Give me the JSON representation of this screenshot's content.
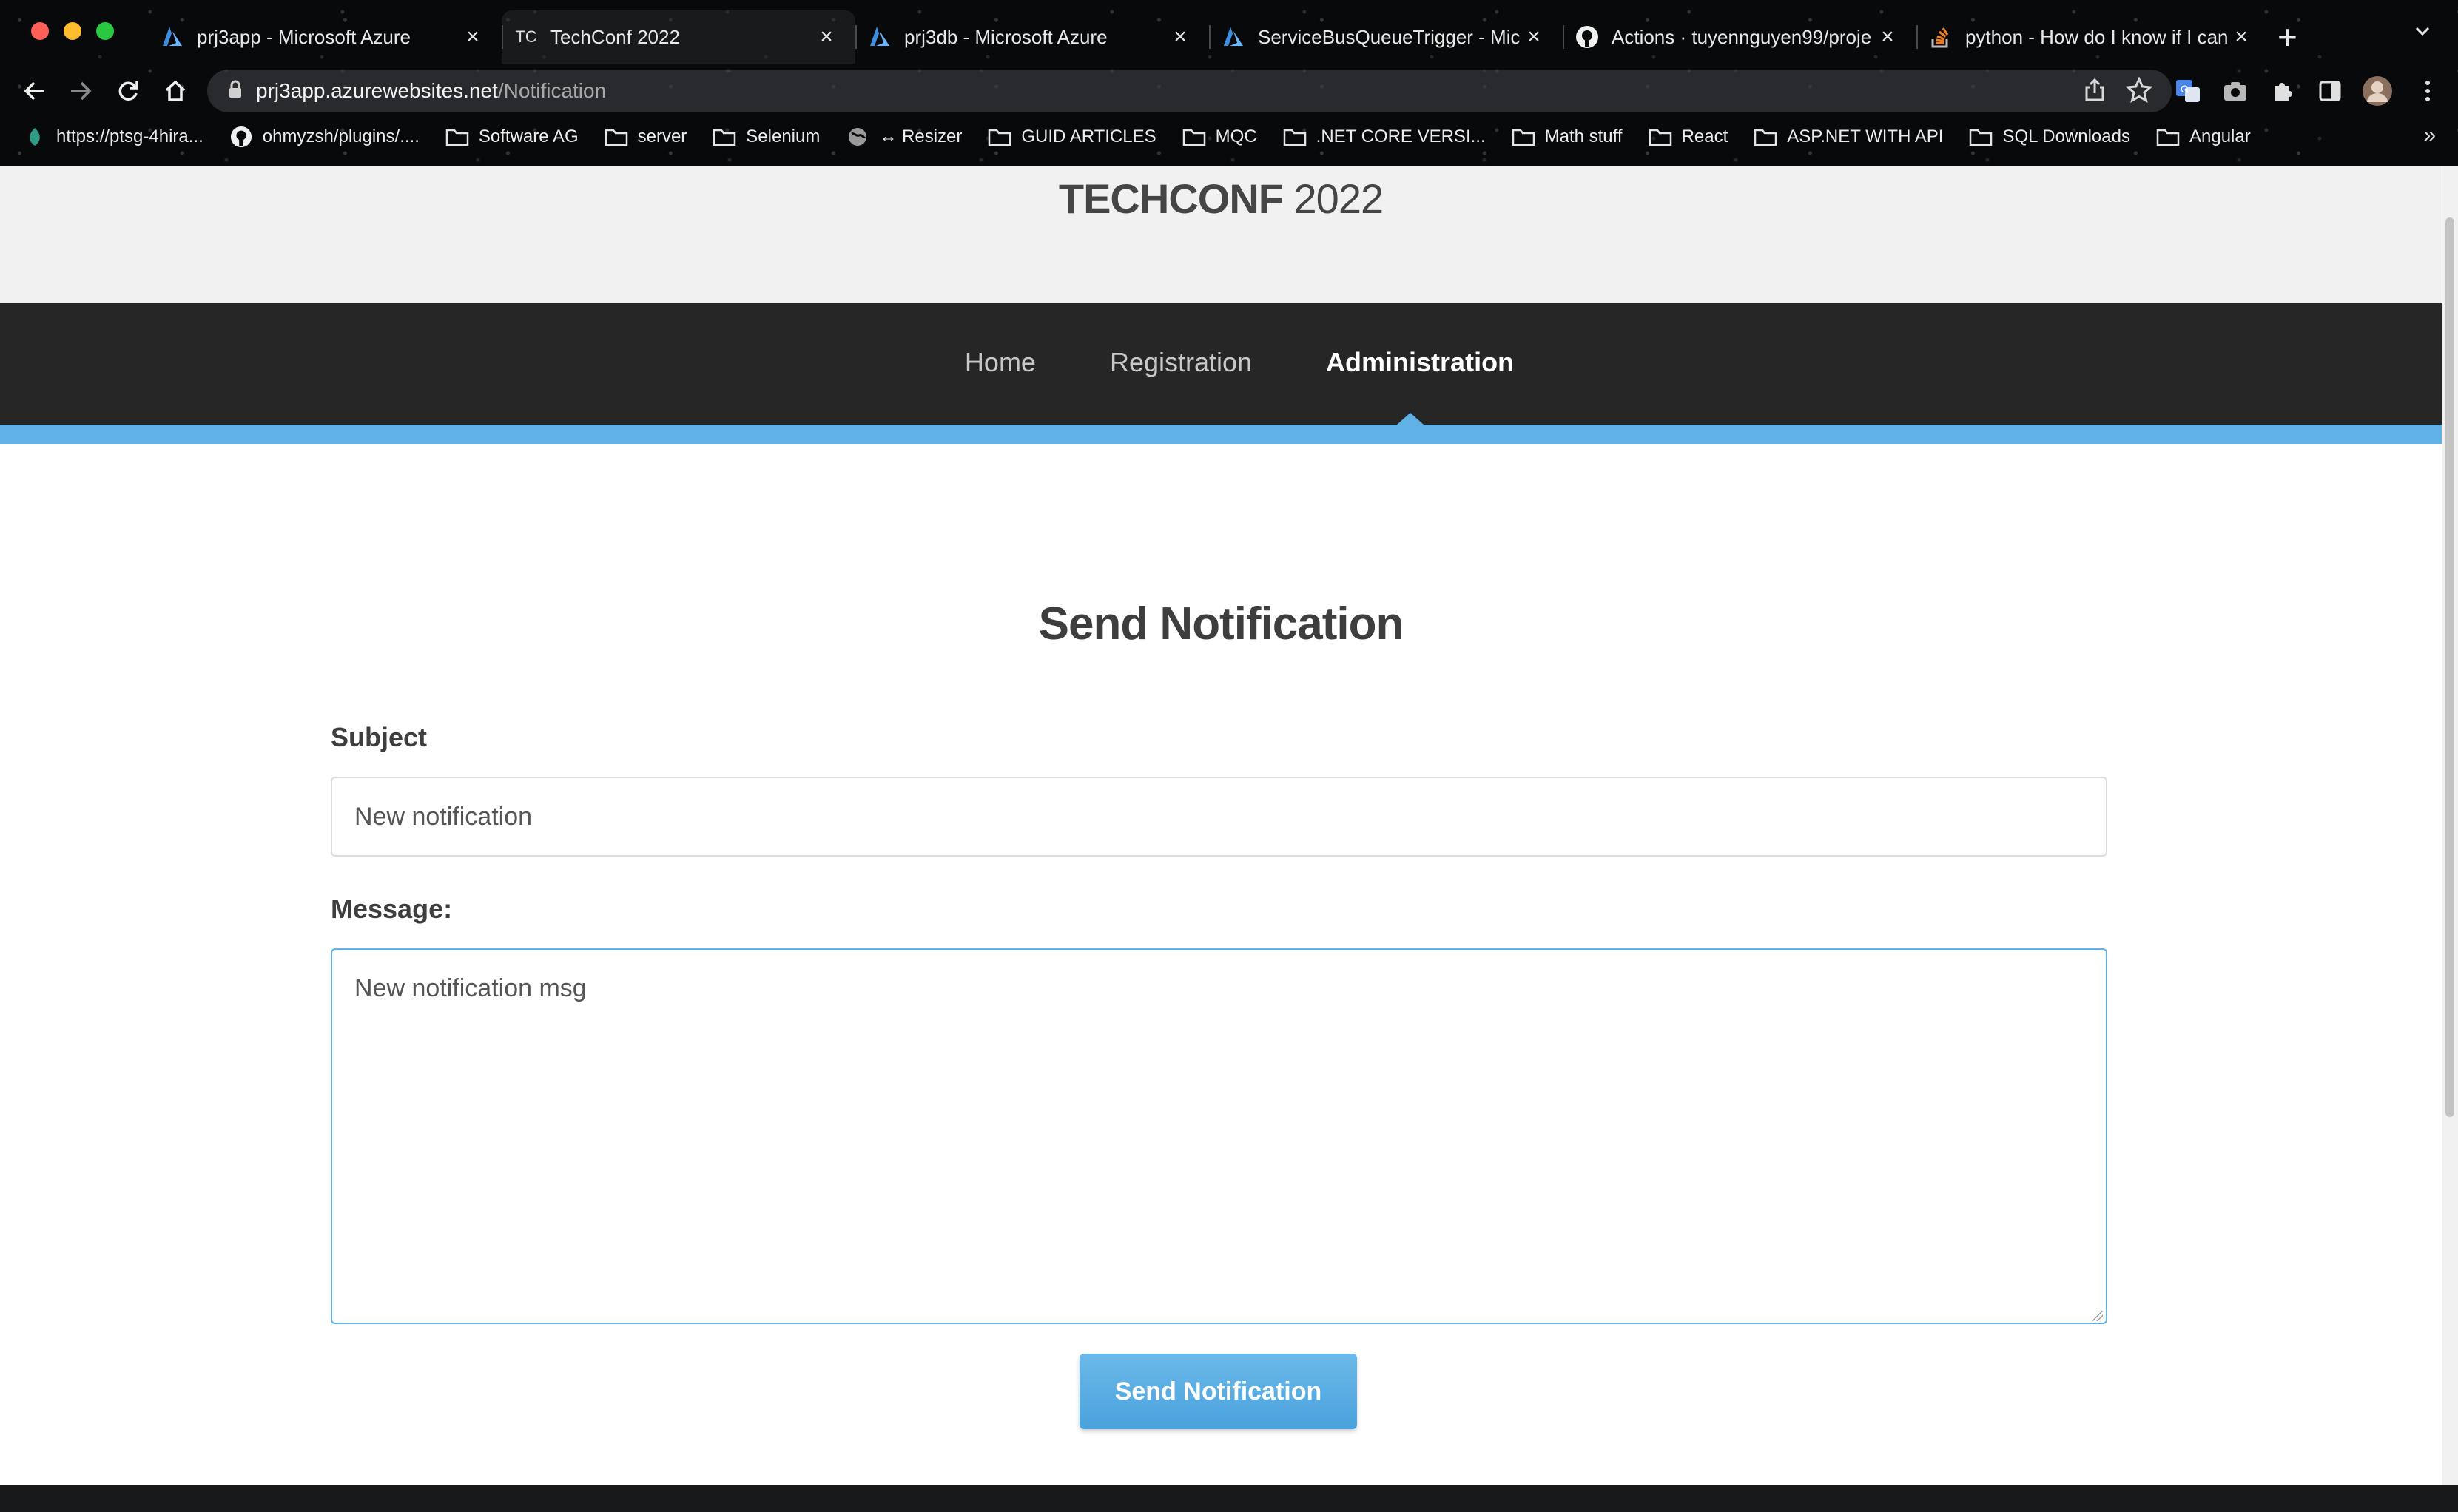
{
  "browser": {
    "tabs": [
      {
        "label": "prj3app - Microsoft Azure",
        "icon": "azure-icon",
        "active": false
      },
      {
        "label": "TechConf 2022",
        "icon": "techconf-icon",
        "icon_text": "TC",
        "active": true
      },
      {
        "label": "prj3db - Microsoft Azure",
        "icon": "azure-icon",
        "active": false
      },
      {
        "label": "ServiceBusQueueTrigger - Micr",
        "icon": "azure-icon",
        "active": false
      },
      {
        "label": "Actions · tuyennguyen99/proje",
        "icon": "github-icon",
        "active": false
      },
      {
        "label": "python - How do I know if I can",
        "icon": "stackoverflow-icon",
        "active": false
      }
    ],
    "new_tab": "+",
    "address": {
      "host": "prj3app.azurewebsites.net",
      "path": "/Notification"
    },
    "bookmarks": [
      {
        "label": "https://ptsg-4hira...",
        "icon": "leaf-icon"
      },
      {
        "label": "ohmyzsh/plugins/....",
        "icon": "github-icon"
      },
      {
        "label": "Software AG",
        "icon": "folder-icon"
      },
      {
        "label": "server",
        "icon": "folder-icon"
      },
      {
        "label": "Selenium",
        "icon": "folder-icon"
      },
      {
        "label": "↔ Resizer",
        "icon": "globe-icon"
      },
      {
        "label": "GUID ARTICLES",
        "icon": "folder-icon"
      },
      {
        "label": "MQC",
        "icon": "folder-icon"
      },
      {
        "label": ".NET CORE VERSI...",
        "icon": "folder-icon"
      },
      {
        "label": "Math stuff",
        "icon": "folder-icon"
      },
      {
        "label": "React",
        "icon": "folder-icon"
      },
      {
        "label": "ASP.NET WITH API",
        "icon": "folder-icon"
      },
      {
        "label": "SQL Downloads",
        "icon": "folder-icon"
      },
      {
        "label": "Angular",
        "icon": "folder-icon"
      }
    ],
    "more_bookmarks": "»"
  },
  "site": {
    "brand_bold": "TECHCONF",
    "brand_year": " 2022",
    "nav": [
      {
        "label": "Home",
        "current": false
      },
      {
        "label": "Registration",
        "current": false
      },
      {
        "label": "Administration",
        "current": true
      }
    ]
  },
  "form": {
    "title": "Send Notification",
    "subject_label": "Subject",
    "subject_value": "New notification",
    "message_label": "Message:",
    "message_value": "New notification msg",
    "submit_label": "Send Notification"
  },
  "colors": {
    "accent": "#5fb1e6",
    "nav_bg": "#262626",
    "text": "#3e3e3e"
  }
}
